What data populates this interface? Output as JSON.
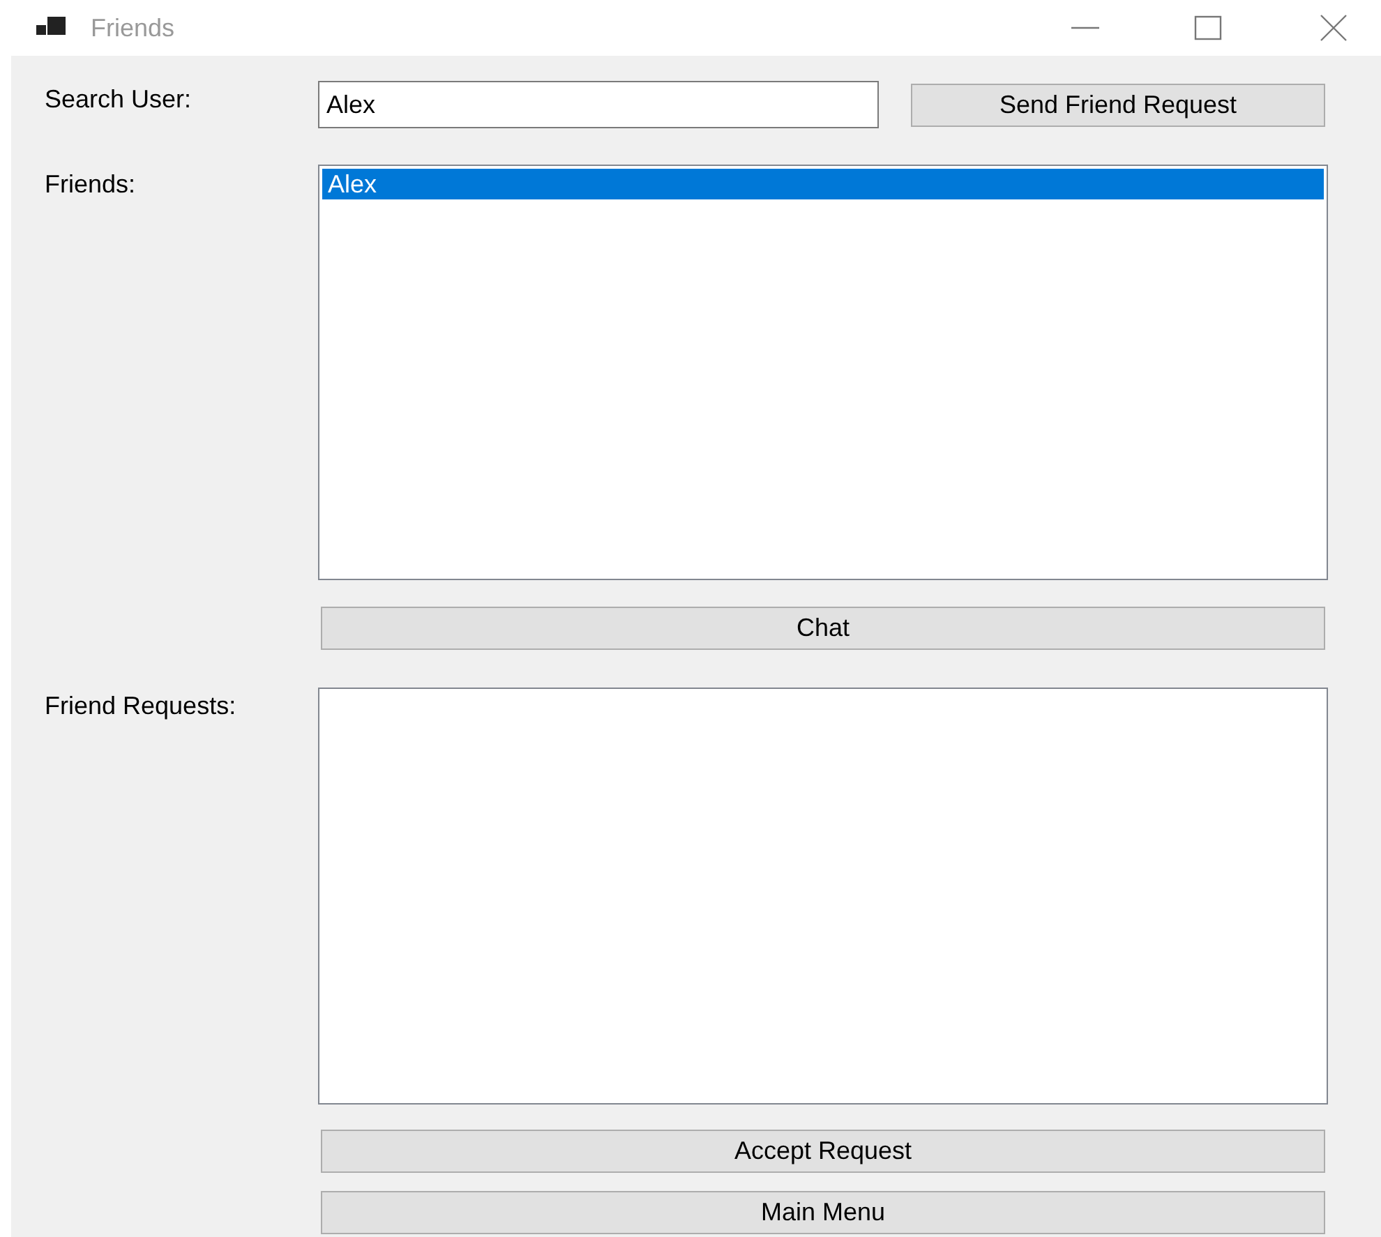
{
  "window": {
    "title": "Friends"
  },
  "search": {
    "label": "Search User:",
    "value": "Alex",
    "button": "Send Friend Request"
  },
  "friends": {
    "label": "Friends:",
    "items": [
      {
        "name": "Alex",
        "selected": true
      }
    ],
    "button": "Chat"
  },
  "requests": {
    "label": "Friend Requests:",
    "buttons": [
      "Accept Request",
      "Main Menu"
    ]
  }
}
